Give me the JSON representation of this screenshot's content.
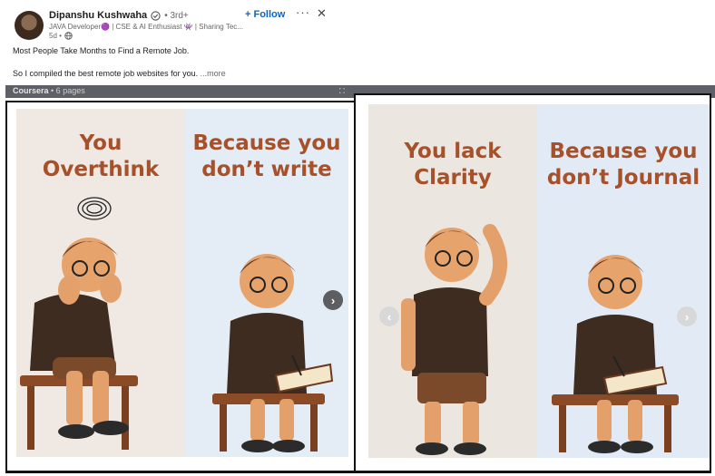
{
  "author": {
    "name": "Dipanshu Kushwaha",
    "degree": "• 3rd+",
    "headline": "JAVA Developer🟣 | CSE & AI Enthusiast 👾 | Sharing Tec...",
    "time": "5d •",
    "verified_icon": "verified-shield-icon",
    "visibility_icon": "globe-icon"
  },
  "actions": {
    "follow_label": "+ Follow",
    "more_label": "···",
    "close_label": "✕"
  },
  "post": {
    "line1": "Most People Take Months to Find a Remote Job.",
    "line2": "So I compiled the best remote job websites for you.",
    "see_more": "...more"
  },
  "document": {
    "source": "Coursera",
    "pages": "• 6 pages"
  },
  "slides": {
    "left": {
      "panel_a": [
        "You",
        "Overthink"
      ],
      "panel_b": [
        "Because you",
        "don’t write"
      ]
    },
    "right": {
      "panel_a": [
        "You lack",
        "Clarity"
      ],
      "panel_b": [
        "Because you",
        "don’t Journal"
      ]
    }
  },
  "nav": {
    "next_glyph": "›",
    "prev_glyph": "‹"
  },
  "colors": {
    "accent": "#0a66c2",
    "slide_text": "#a6512a",
    "doc_bar": "#5d6066"
  }
}
